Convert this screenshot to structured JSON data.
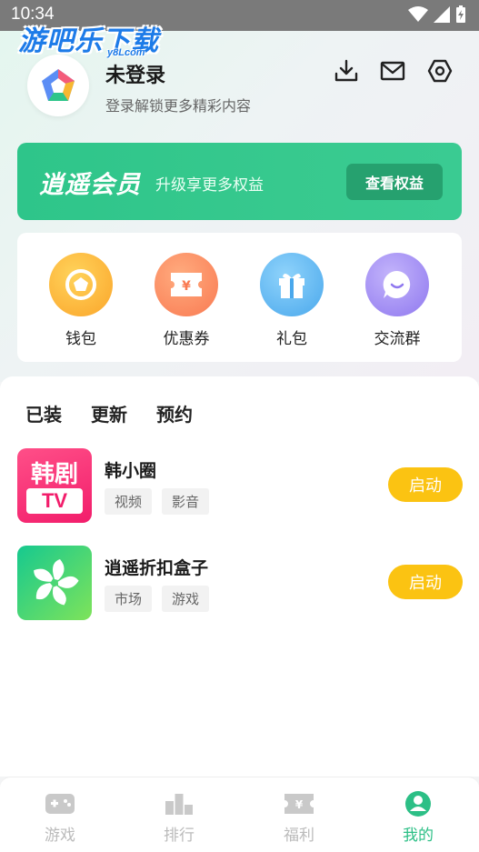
{
  "status": {
    "time": "10:34"
  },
  "watermark": {
    "text": "游吧乐下载",
    "sub": "y8Lcom"
  },
  "profile": {
    "name": "未登录",
    "subtitle": "登录解锁更多精彩内容"
  },
  "header_icons": [
    "download-icon",
    "mail-icon",
    "settings-icon"
  ],
  "vip": {
    "title": "逍遥会员",
    "subtitle": "升级享更多权益",
    "button": "查看权益"
  },
  "quick_actions": [
    {
      "label": "钱包",
      "icon": "wallet-icon",
      "color": "#fbb22d"
    },
    {
      "label": "优惠券",
      "icon": "coupon-icon",
      "color": "#fb8a5e"
    },
    {
      "label": "礼包",
      "icon": "gift-icon",
      "color": "#5bb4f0"
    },
    {
      "label": "交流群",
      "icon": "chat-icon",
      "color": "#9b86f1"
    }
  ],
  "tabs": [
    {
      "label": "已装",
      "active": true
    },
    {
      "label": "更新",
      "active": false
    },
    {
      "label": "预约",
      "active": false
    }
  ],
  "apps": [
    {
      "name": "韩小圈",
      "tags": [
        "视频",
        "影音"
      ],
      "button": "启动",
      "icon_text": "韩剧",
      "icon_sub": "TV"
    },
    {
      "name": "逍遥折扣盒子",
      "tags": [
        "市场",
        "游戏"
      ],
      "button": "启动"
    }
  ],
  "bottom_nav": [
    {
      "label": "游戏",
      "icon": "gamepad-icon",
      "active": false
    },
    {
      "label": "排行",
      "icon": "ranking-icon",
      "active": false
    },
    {
      "label": "福利",
      "icon": "welfare-icon",
      "active": false
    },
    {
      "label": "我的",
      "icon": "profile-icon",
      "active": true
    }
  ],
  "colors": {
    "accent": "#2cbf86",
    "launch": "#fbc312",
    "vip_bg": "#2ec58a"
  }
}
